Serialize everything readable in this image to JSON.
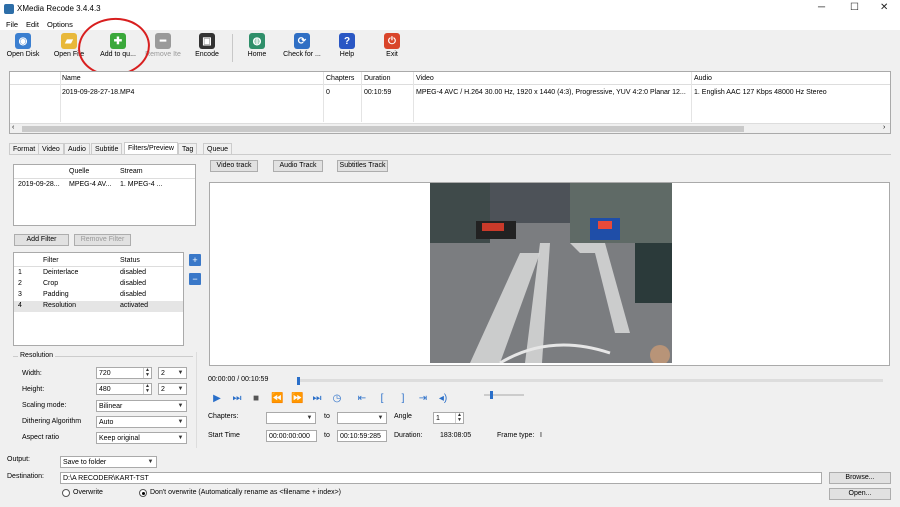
{
  "window": {
    "title": "XMedia Recode 3.4.4.3",
    "controls": [
      "─",
      "☐",
      "✕"
    ]
  },
  "menu": [
    "File",
    "Edit",
    "Options"
  ],
  "toolbar": [
    {
      "label": "Open Disk",
      "icon": "disc-icon",
      "color": "#3b7fd0",
      "glyph": "◉",
      "enabled": true
    },
    {
      "label": "Open File",
      "icon": "folder-icon",
      "color": "#e8b83a",
      "glyph": "▰",
      "enabled": true
    },
    {
      "label": "Add to qu...",
      "icon": "plus-icon",
      "color": "#3aa83a",
      "glyph": "✚",
      "enabled": true
    },
    {
      "label": "Remove Ite",
      "icon": "minus-icon",
      "color": "#9a9a9a",
      "glyph": "━",
      "enabled": false
    },
    {
      "label": "Encode",
      "icon": "film-icon",
      "color": "#333333",
      "glyph": "▣",
      "enabled": true
    },
    {
      "label": "Home",
      "icon": "globe-icon",
      "color": "#2f8f6a",
      "glyph": "◍",
      "enabled": true
    },
    {
      "label": "Check for ...",
      "icon": "refresh-icon",
      "color": "#2f6fc4",
      "glyph": "⟳",
      "enabled": true
    },
    {
      "label": "Help",
      "icon": "help-icon",
      "color": "#2a57c4",
      "glyph": "?",
      "enabled": true
    },
    {
      "label": "Exit",
      "icon": "power-icon",
      "color": "#d9452a",
      "glyph": "⏻",
      "enabled": true
    }
  ],
  "filelist": {
    "headers": {
      "name": "Name",
      "chapters": "Chapters",
      "duration": "Duration",
      "video": "Video",
      "audio": "Audio"
    },
    "row": {
      "name": "2019-09-28-27-18.MP4",
      "chapters": "0",
      "duration": "00:10:59",
      "video": "MPEG-4 AVC / H.264 30.00 Hz, 1920 x 1440 (4:3), Progressive, YUV 4:2:0 Planar 12...",
      "audio": "1. English AAC  127 Kbps 48000 Hz Stereo"
    }
  },
  "tabs": [
    "Format",
    "Video",
    "Audio",
    "Subtitle",
    "Filters/Preview",
    "Tag",
    "Queue"
  ],
  "active_tab": "Filters/Preview",
  "source": {
    "headers": {
      "quelle": "Quelle",
      "stream": "Stream"
    },
    "row": {
      "file": "2019-09-28...",
      "quelle": "MPEG-4 AV...",
      "stream": "1. MPEG-4 ..."
    }
  },
  "filter_buttons": {
    "add": "Add Filter",
    "remove": "Remove Filter"
  },
  "filters": {
    "headers": {
      "filter": "Filter",
      "status": "Status"
    },
    "rows": [
      {
        "n": "1",
        "name": "Deinterlace",
        "status": "disabled"
      },
      {
        "n": "2",
        "name": "Crop",
        "status": "disabled"
      },
      {
        "n": "3",
        "name": "Padding",
        "status": "disabled"
      },
      {
        "n": "4",
        "name": "Resolution",
        "status": "activated"
      }
    ]
  },
  "resolution": {
    "group_label": "Resolution",
    "width_label": "Width:",
    "width_value": "720",
    "width_step": "2",
    "height_label": "Height:",
    "height_value": "480",
    "height_step": "2",
    "scaling_label": "Scaling mode:",
    "scaling_value": "Bilinear",
    "dithering_label": "Dithering Algorithm",
    "dithering_value": "Auto",
    "aspect_label": "Aspect ratio",
    "aspect_value": "Keep original"
  },
  "track_buttons": {
    "video": "Video track",
    "audio": "Audio Track",
    "subtitles": "Subtitles Track"
  },
  "playback": {
    "time": "00:00:00 / 00:10:59",
    "position": 0.0,
    "volume": 0.15,
    "chapters_label": "Chapters:",
    "to_label": "to",
    "angle_label": "Angle",
    "angle_value": "1",
    "start_label": "Start Time",
    "start_value": "00:00:00:000",
    "end_value": "00:10:59:285",
    "duration_label": "Duration:",
    "duration_value": "183:08:05",
    "frame_type_label": "Frame type:",
    "frame_type_value": "I"
  },
  "output": {
    "output_label": "Output:",
    "output_value": "Save to folder",
    "destination_label": "Destination:",
    "destination_value": "D:\\A RECODER\\KART-TST",
    "browse": "Browse...",
    "open": "Open...",
    "overwrite": "Overwrite",
    "dont_overwrite": "Don't overwrite (Automatically rename as <filename + index>)"
  },
  "accent": "#2a6fc9",
  "annotation_color": "#d81f1f"
}
